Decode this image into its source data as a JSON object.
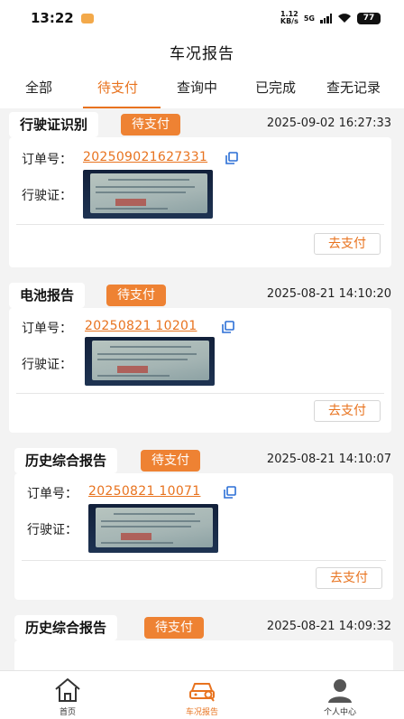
{
  "status_bar": {
    "time": "13:22",
    "net_speed_value": "1.12",
    "net_speed_unit": "KB/s",
    "network": "5G",
    "battery": "77"
  },
  "header": {
    "title": "车况报告"
  },
  "tabs": [
    {
      "label": "全部",
      "active": false
    },
    {
      "label": "待支付",
      "active": true
    },
    {
      "label": "查询中",
      "active": false
    },
    {
      "label": "已完成",
      "active": false
    },
    {
      "label": "查无记录",
      "active": false
    }
  ],
  "labels": {
    "order_number": "订单号：",
    "license": "行驶证：",
    "pay_button": "去支付"
  },
  "orders": [
    {
      "type": "行驶证识别",
      "status": "待支付",
      "datetime": "2025-09-02 16:27:33",
      "order_number": "202509021627331"
    },
    {
      "type": "电池报告",
      "status": "待支付",
      "datetime": "2025-08-21 14:10:20",
      "order_number": "20250821 10201"
    },
    {
      "type": "历史综合报告",
      "status": "待支付",
      "datetime": "2025-08-21 14:10:07",
      "order_number": "20250821 10071"
    },
    {
      "type": "历史综合报告",
      "status": "待支付",
      "datetime": "2025-08-21 14:09:32"
    }
  ],
  "bottom_nav": [
    {
      "label": "首页",
      "icon": "home-icon",
      "active": false
    },
    {
      "label": "车况报告",
      "icon": "car-report-icon",
      "active": true
    },
    {
      "label": "个人中心",
      "icon": "person-icon",
      "active": false
    }
  ],
  "colors": {
    "accent": "#e8731f",
    "tag_background": "#ee8233",
    "background": "#f3f3f3"
  }
}
